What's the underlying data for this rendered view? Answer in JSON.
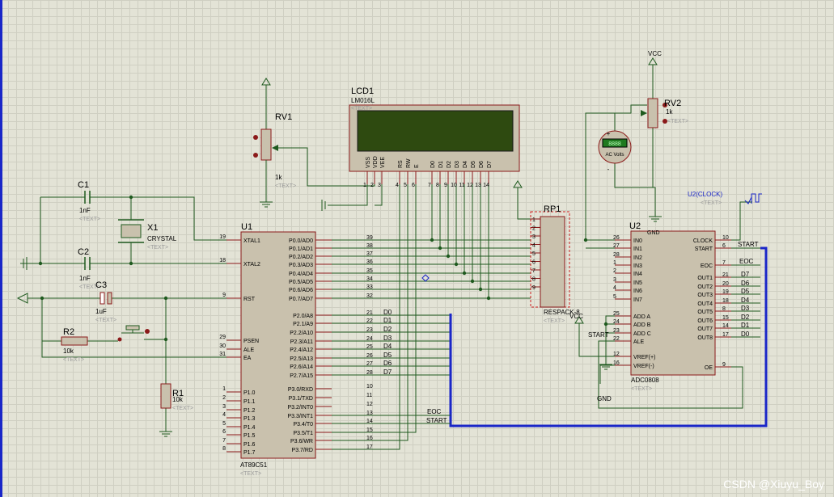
{
  "watermark": "CSDN @Xiuyu_Boy",
  "lcd": {
    "ref": "LCD1",
    "part": "LM016L",
    "text": "<TEXT>",
    "pins": [
      "VSS",
      "VDD",
      "VEE",
      "RS",
      "RW",
      "E",
      "D0",
      "D1",
      "D2",
      "D3",
      "D4",
      "D5",
      "D6",
      "D7"
    ],
    "nums": [
      "1",
      "2",
      "3",
      "4",
      "5",
      "6",
      "7",
      "8",
      "9",
      "10",
      "11",
      "12",
      "13",
      "14"
    ]
  },
  "rv1": {
    "ref": "RV1",
    "val": "1k",
    "text": "<TEXT>"
  },
  "rv2": {
    "ref": "RV2",
    "val": "1k",
    "text": "<TEXT>"
  },
  "vcc": "VCC",
  "gnd": "GND",
  "c1": {
    "ref": "C1",
    "val": "1nF",
    "text": "<TEXT>"
  },
  "c2": {
    "ref": "C2",
    "val": "1nF",
    "text": "<TEXT>"
  },
  "c3": {
    "ref": "C3",
    "val": "1uF",
    "text": "<TEXT>"
  },
  "x1": {
    "ref": "X1",
    "val": "CRYSTAL",
    "text": "<TEXT>"
  },
  "r1": {
    "ref": "R1",
    "val": "10k",
    "text": "<TEXT>"
  },
  "r2": {
    "ref": "R2",
    "val": "10k",
    "text": "<TEXT>"
  },
  "rp1": {
    "ref": "RP1",
    "val": "RESPACK-8",
    "text": "<TEXT>",
    "pins": [
      "1",
      "2",
      "3",
      "4",
      "5",
      "6",
      "7",
      "8",
      "9"
    ]
  },
  "voltmeter": {
    "display": "8888",
    "unit": "AC Volts",
    "plus": "+",
    "minus": "-"
  },
  "clock": {
    "label": "U2(CLOCK)",
    "text": "<TEXT>"
  },
  "u1": {
    "ref": "U1",
    "part": "AT89C51",
    "text": "<TEXT>",
    "left": [
      [
        "XTAL1",
        "19"
      ],
      [
        "XTAL2",
        "18"
      ],
      [
        "RST",
        "9"
      ],
      [
        "PSEN",
        "29"
      ],
      [
        "ALE",
        "30"
      ],
      [
        "EA",
        "31"
      ],
      [
        "P1.0",
        "1"
      ],
      [
        "P1.1",
        "2"
      ],
      [
        "P1.2",
        "3"
      ],
      [
        "P1.3",
        "4"
      ],
      [
        "P1.4",
        "5"
      ],
      [
        "P1.5",
        "6"
      ],
      [
        "P1.6",
        "7"
      ],
      [
        "P1.7",
        "8"
      ]
    ],
    "right": [
      [
        "P0.0/AD0",
        "39"
      ],
      [
        "P0.1/AD1",
        "38"
      ],
      [
        "P0.2/AD2",
        "37"
      ],
      [
        "P0.3/AD3",
        "36"
      ],
      [
        "P0.4/AD4",
        "35"
      ],
      [
        "P0.5/AD5",
        "34"
      ],
      [
        "P0.6/AD6",
        "33"
      ],
      [
        "P0.7/AD7",
        "32"
      ],
      [
        "P2.0/A8",
        "21"
      ],
      [
        "P2.1/A9",
        "22"
      ],
      [
        "P2.2/A10",
        "23"
      ],
      [
        "P2.3/A11",
        "24"
      ],
      [
        "P2.4/A12",
        "25"
      ],
      [
        "P2.5/A13",
        "26"
      ],
      [
        "P2.6/A14",
        "27"
      ],
      [
        "P2.7/A15",
        "28"
      ],
      [
        "P3.0/RXD",
        "10"
      ],
      [
        "P3.1/TXD",
        "11"
      ],
      [
        "P3.2/INT0",
        "12"
      ],
      [
        "P3.3/INT1",
        "13"
      ],
      [
        "P3.4/T0",
        "14"
      ],
      [
        "P3.5/T1",
        "15"
      ],
      [
        "P3.6/WR",
        "16"
      ],
      [
        "P3.7/RD",
        "17"
      ]
    ]
  },
  "u2": {
    "ref": "U2",
    "part": "ADC0808",
    "text": "<TEXT>",
    "left": [
      [
        "IN0",
        "26"
      ],
      [
        "IN1",
        "27"
      ],
      [
        "IN2",
        "28"
      ],
      [
        "IN3",
        "1"
      ],
      [
        "IN4",
        "2"
      ],
      [
        "IN5",
        "3"
      ],
      [
        "IN6",
        "4"
      ],
      [
        "IN7",
        "5"
      ],
      [
        "ADD A",
        "25"
      ],
      [
        "ADD B",
        "24"
      ],
      [
        "ADD C",
        "23"
      ],
      [
        "ALE",
        "22"
      ],
      [
        "VREF(+)",
        "12"
      ],
      [
        "VREF(-)",
        "16"
      ]
    ],
    "right": [
      [
        "CLOCK",
        "10"
      ],
      [
        "START",
        "6"
      ],
      [
        "EOC",
        "7"
      ],
      [
        "OUT1",
        "21"
      ],
      [
        "OUT2",
        "20"
      ],
      [
        "OUT3",
        "19"
      ],
      [
        "OUT4",
        "18"
      ],
      [
        "OUT5",
        "8"
      ],
      [
        "OUT6",
        "15"
      ],
      [
        "OUT7",
        "14"
      ],
      [
        "OUT8",
        "17"
      ],
      [
        "OE",
        "9"
      ]
    ]
  },
  "labels": {
    "d": [
      "D0",
      "D1",
      "D2",
      "D3",
      "D4",
      "D5",
      "D6",
      "D7"
    ],
    "dout": [
      "D7",
      "D6",
      "D5",
      "D4",
      "D3",
      "D2",
      "D1",
      "D0"
    ],
    "eoc": "EOC",
    "start": "START",
    "start2": "START",
    "start3": "START",
    "eoc2": "EOC"
  }
}
